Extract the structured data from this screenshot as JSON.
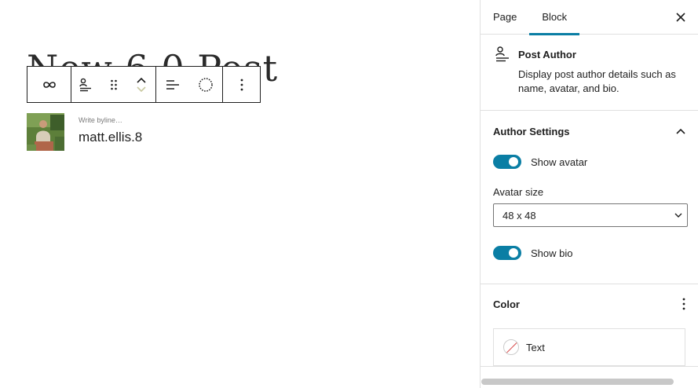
{
  "canvas": {
    "post_title": "New 6.0 Post",
    "byline_placeholder": "Write byline…",
    "author_name": "matt.ellis.8"
  },
  "toolbar": {
    "icons": [
      "link-icon",
      "post-author-icon",
      "drag-handle-icon",
      "move-up-icon",
      "move-down-icon",
      "align-left-icon",
      "circle-dotted-icon",
      "more-options-icon"
    ]
  },
  "sidebar": {
    "tabs": [
      {
        "label": "Page",
        "active": false
      },
      {
        "label": "Block",
        "active": true
      }
    ],
    "block": {
      "title": "Post Author",
      "description": "Display post author details such as name, avatar, and bio."
    },
    "author_settings": {
      "title": "Author Settings",
      "show_avatar_label": "Show avatar",
      "show_avatar": true,
      "avatar_size_label": "Avatar size",
      "avatar_size_value": "48 x 48",
      "show_bio_label": "Show bio",
      "show_bio": true
    },
    "color": {
      "title": "Color",
      "items": [
        {
          "label": "Text"
        }
      ]
    }
  },
  "colors": {
    "accent": "#0a7ea4",
    "border": "#e0e0e0",
    "text": "#1e1e1e"
  }
}
